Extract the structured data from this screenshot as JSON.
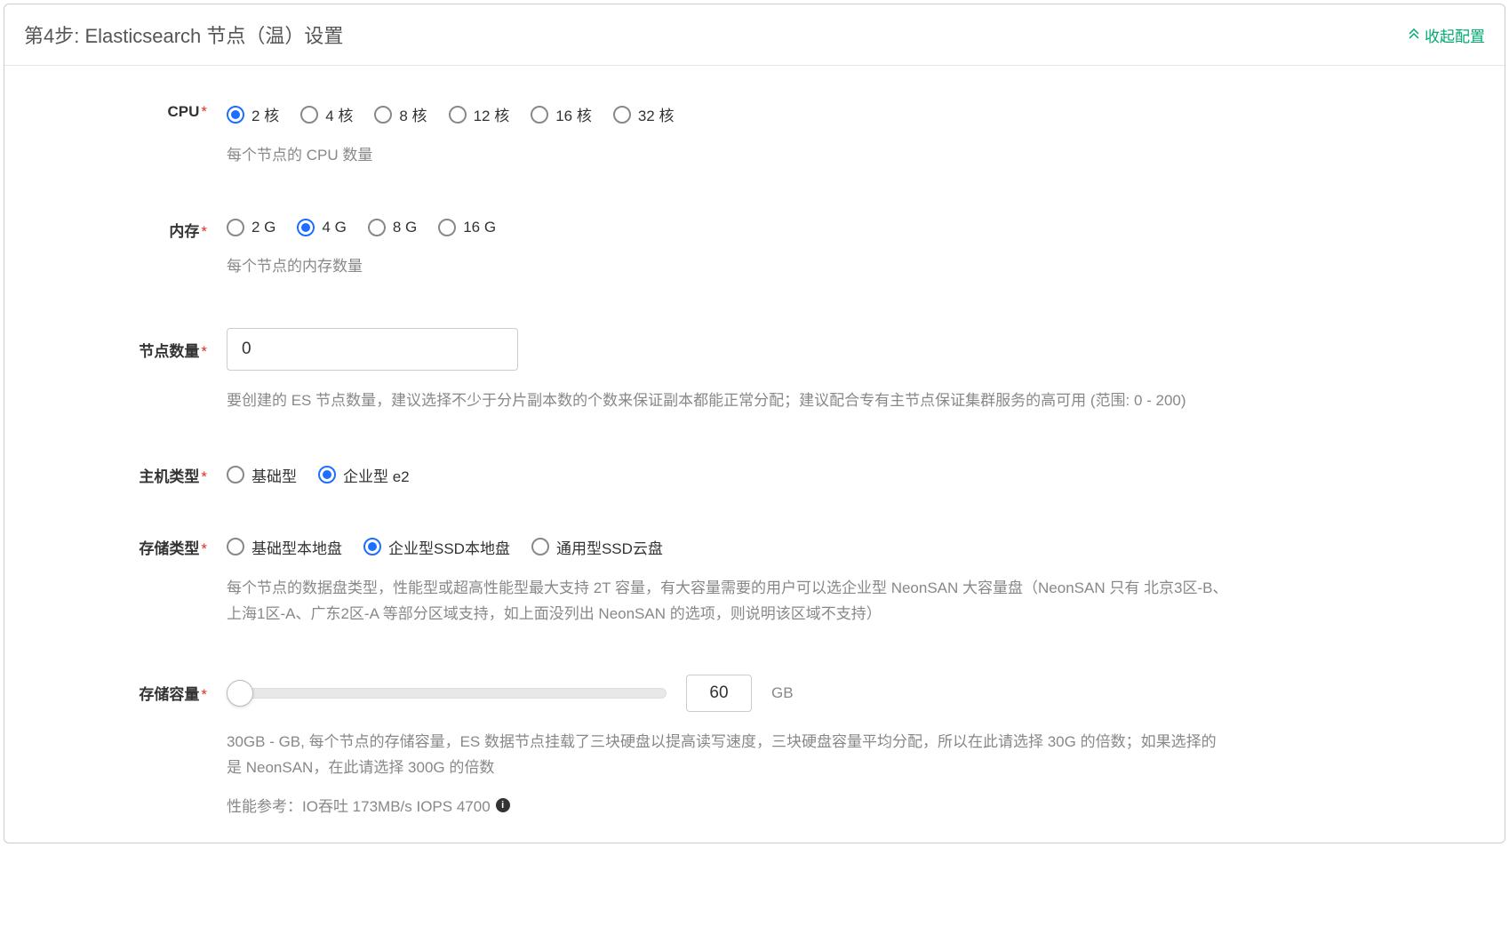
{
  "header": {
    "title": "第4步: Elasticsearch 节点（温）设置",
    "collapse_label": "收起配置"
  },
  "cpu": {
    "label": "CPU",
    "options": [
      "2 核",
      "4 核",
      "8 核",
      "12 核",
      "16 核",
      "32 核"
    ],
    "selected": 0,
    "help": "每个节点的 CPU 数量"
  },
  "memory": {
    "label": "内存",
    "options": [
      "2 G",
      "4 G",
      "8 G",
      "16 G"
    ],
    "selected": 1,
    "help": "每个节点的内存数量"
  },
  "node_count": {
    "label": "节点数量",
    "value": "0",
    "help": "要创建的 ES 节点数量，建议选择不少于分片副本数的个数来保证副本都能正常分配；建议配合专有主节点保证集群服务的高可用 (范围: 0 - 200)"
  },
  "host_type": {
    "label": "主机类型",
    "options": [
      "基础型",
      "企业型 e2"
    ],
    "selected": 1
  },
  "storage_type": {
    "label": "存储类型",
    "options": [
      "基础型本地盘",
      "企业型SSD本地盘",
      "通用型SSD云盘"
    ],
    "selected": 1,
    "help": "每个节点的数据盘类型，性能型或超高性能型最大支持 2T 容量，有大容量需要的用户可以选企业型 NeonSAN 大容量盘（NeonSAN 只有 北京3区-B、上海1区-A、广东2区-A 等部分区域支持，如上面没列出 NeonSAN 的选项，则说明该区域不支持）"
  },
  "storage_capacity": {
    "label": "存储容量",
    "value": "60",
    "unit": "GB",
    "help": "30GB - GB, 每个节点的存储容量，ES 数据节点挂载了三块硬盘以提高读写速度，三块硬盘容量平均分配，所以在此请选择 30G 的倍数；如果选择的是 NeonSAN，在此请选择 300G 的倍数",
    "perf": "性能参考：IO吞吐 173MB/s  IOPS 4700"
  }
}
